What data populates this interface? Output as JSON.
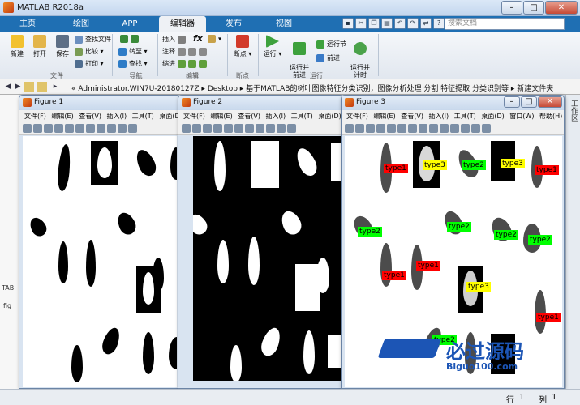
{
  "app": {
    "title": "MATLAB R2018a"
  },
  "tabs": [
    {
      "label": "主页"
    },
    {
      "label": "绘图"
    },
    {
      "label": "APP"
    },
    {
      "label": "编辑器"
    },
    {
      "label": "发布"
    },
    {
      "label": "视图"
    }
  ],
  "search": {
    "placeholder": "搜索文档"
  },
  "toolstrip": {
    "file": {
      "new": "新建",
      "open": "打开",
      "save": "保存",
      "find_files": "查找文件",
      "compare": "比较",
      "print": "打印",
      "group": "文件"
    },
    "nav": {
      "goto": "转至",
      "find": "查找",
      "group": "导航"
    },
    "edit": {
      "insert": "插入",
      "comment": "注释",
      "indent": "缩进",
      "fx": "fx",
      "group": "编辑"
    },
    "breakpoints": {
      "label": "断点",
      "group": "断点"
    },
    "run": {
      "run": "运行",
      "run_advance": "运行并\n前进",
      "run_section": "运行节",
      "advance": "前进",
      "run_time": "运行并\n计时",
      "group": "运行"
    }
  },
  "address": {
    "path": "«  Administrator.WIN7U-20180127Z  ▸  Desktop  ▸  基于MATLAB的树叶图像特征分类识别，图像分析处理 分割 特征提取 分类识别等  ▸  新建文件夹"
  },
  "left_panel": {
    "tab": "TAB",
    "item": "fig"
  },
  "right_panel": {
    "label": "工作区"
  },
  "figures": [
    {
      "title": "Figure 1",
      "menu": [
        "文件(F)",
        "编辑(E)",
        "查看(V)",
        "插入(I)",
        "工具(T)",
        "桌面(D)"
      ]
    },
    {
      "title": "Figure 2",
      "menu": [
        "文件(F)",
        "编辑(E)",
        "查看(V)",
        "插入(I)",
        "工具(T)",
        "桌面(D)"
      ]
    },
    {
      "title": "Figure 3",
      "menu": [
        "文件(F)",
        "编辑(E)",
        "查看(V)",
        "插入(I)",
        "工具(T)",
        "桌面(D)",
        "窗口(W)",
        "帮助(H)"
      ],
      "labels": [
        "type1",
        "type3",
        "type2",
        "type3",
        "type1",
        "type2",
        "type2",
        "type2",
        "type2",
        "type1",
        "type1",
        "type3",
        "type1",
        "type2"
      ]
    }
  ],
  "status": {
    "row_label": "行",
    "row": "1",
    "col_label": "列",
    "col": "1"
  },
  "watermark": {
    "text": "必过源码",
    "site": "Biguo100.com"
  },
  "colors": {
    "type1": "#ff0000",
    "type2": "#00ff00",
    "type3": "#ffff00",
    "ribbon": "#1f6fb3"
  }
}
